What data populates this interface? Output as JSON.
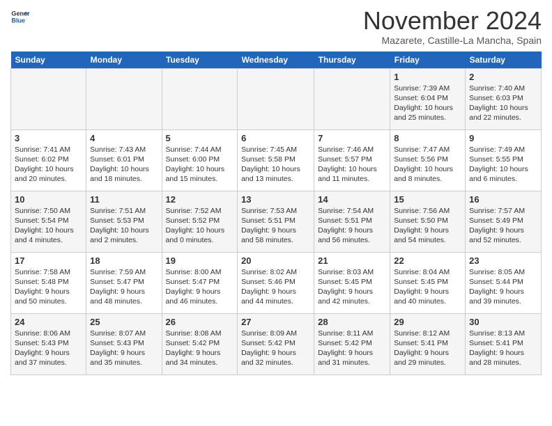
{
  "header": {
    "logo_general": "General",
    "logo_blue": "Blue",
    "month_title": "November 2024",
    "location": "Mazarete, Castille-La Mancha, Spain"
  },
  "days_of_week": [
    "Sunday",
    "Monday",
    "Tuesday",
    "Wednesday",
    "Thursday",
    "Friday",
    "Saturday"
  ],
  "weeks": [
    [
      {
        "day": "",
        "content": ""
      },
      {
        "day": "",
        "content": ""
      },
      {
        "day": "",
        "content": ""
      },
      {
        "day": "",
        "content": ""
      },
      {
        "day": "",
        "content": ""
      },
      {
        "day": "1",
        "content": "Sunrise: 7:39 AM\nSunset: 6:04 PM\nDaylight: 10 hours and 25 minutes."
      },
      {
        "day": "2",
        "content": "Sunrise: 7:40 AM\nSunset: 6:03 PM\nDaylight: 10 hours and 22 minutes."
      }
    ],
    [
      {
        "day": "3",
        "content": "Sunrise: 7:41 AM\nSunset: 6:02 PM\nDaylight: 10 hours and 20 minutes."
      },
      {
        "day": "4",
        "content": "Sunrise: 7:43 AM\nSunset: 6:01 PM\nDaylight: 10 hours and 18 minutes."
      },
      {
        "day": "5",
        "content": "Sunrise: 7:44 AM\nSunset: 6:00 PM\nDaylight: 10 hours and 15 minutes."
      },
      {
        "day": "6",
        "content": "Sunrise: 7:45 AM\nSunset: 5:58 PM\nDaylight: 10 hours and 13 minutes."
      },
      {
        "day": "7",
        "content": "Sunrise: 7:46 AM\nSunset: 5:57 PM\nDaylight: 10 hours and 11 minutes."
      },
      {
        "day": "8",
        "content": "Sunrise: 7:47 AM\nSunset: 5:56 PM\nDaylight: 10 hours and 8 minutes."
      },
      {
        "day": "9",
        "content": "Sunrise: 7:49 AM\nSunset: 5:55 PM\nDaylight: 10 hours and 6 minutes."
      }
    ],
    [
      {
        "day": "10",
        "content": "Sunrise: 7:50 AM\nSunset: 5:54 PM\nDaylight: 10 hours and 4 minutes."
      },
      {
        "day": "11",
        "content": "Sunrise: 7:51 AM\nSunset: 5:53 PM\nDaylight: 10 hours and 2 minutes."
      },
      {
        "day": "12",
        "content": "Sunrise: 7:52 AM\nSunset: 5:52 PM\nDaylight: 10 hours and 0 minutes."
      },
      {
        "day": "13",
        "content": "Sunrise: 7:53 AM\nSunset: 5:51 PM\nDaylight: 9 hours and 58 minutes."
      },
      {
        "day": "14",
        "content": "Sunrise: 7:54 AM\nSunset: 5:51 PM\nDaylight: 9 hours and 56 minutes."
      },
      {
        "day": "15",
        "content": "Sunrise: 7:56 AM\nSunset: 5:50 PM\nDaylight: 9 hours and 54 minutes."
      },
      {
        "day": "16",
        "content": "Sunrise: 7:57 AM\nSunset: 5:49 PM\nDaylight: 9 hours and 52 minutes."
      }
    ],
    [
      {
        "day": "17",
        "content": "Sunrise: 7:58 AM\nSunset: 5:48 PM\nDaylight: 9 hours and 50 minutes."
      },
      {
        "day": "18",
        "content": "Sunrise: 7:59 AM\nSunset: 5:47 PM\nDaylight: 9 hours and 48 minutes."
      },
      {
        "day": "19",
        "content": "Sunrise: 8:00 AM\nSunset: 5:47 PM\nDaylight: 9 hours and 46 minutes."
      },
      {
        "day": "20",
        "content": "Sunrise: 8:02 AM\nSunset: 5:46 PM\nDaylight: 9 hours and 44 minutes."
      },
      {
        "day": "21",
        "content": "Sunrise: 8:03 AM\nSunset: 5:45 PM\nDaylight: 9 hours and 42 minutes."
      },
      {
        "day": "22",
        "content": "Sunrise: 8:04 AM\nSunset: 5:45 PM\nDaylight: 9 hours and 40 minutes."
      },
      {
        "day": "23",
        "content": "Sunrise: 8:05 AM\nSunset: 5:44 PM\nDaylight: 9 hours and 39 minutes."
      }
    ],
    [
      {
        "day": "24",
        "content": "Sunrise: 8:06 AM\nSunset: 5:43 PM\nDaylight: 9 hours and 37 minutes."
      },
      {
        "day": "25",
        "content": "Sunrise: 8:07 AM\nSunset: 5:43 PM\nDaylight: 9 hours and 35 minutes."
      },
      {
        "day": "26",
        "content": "Sunrise: 8:08 AM\nSunset: 5:42 PM\nDaylight: 9 hours and 34 minutes."
      },
      {
        "day": "27",
        "content": "Sunrise: 8:09 AM\nSunset: 5:42 PM\nDaylight: 9 hours and 32 minutes."
      },
      {
        "day": "28",
        "content": "Sunrise: 8:11 AM\nSunset: 5:42 PM\nDaylight: 9 hours and 31 minutes."
      },
      {
        "day": "29",
        "content": "Sunrise: 8:12 AM\nSunset: 5:41 PM\nDaylight: 9 hours and 29 minutes."
      },
      {
        "day": "30",
        "content": "Sunrise: 8:13 AM\nSunset: 5:41 PM\nDaylight: 9 hours and 28 minutes."
      }
    ]
  ]
}
